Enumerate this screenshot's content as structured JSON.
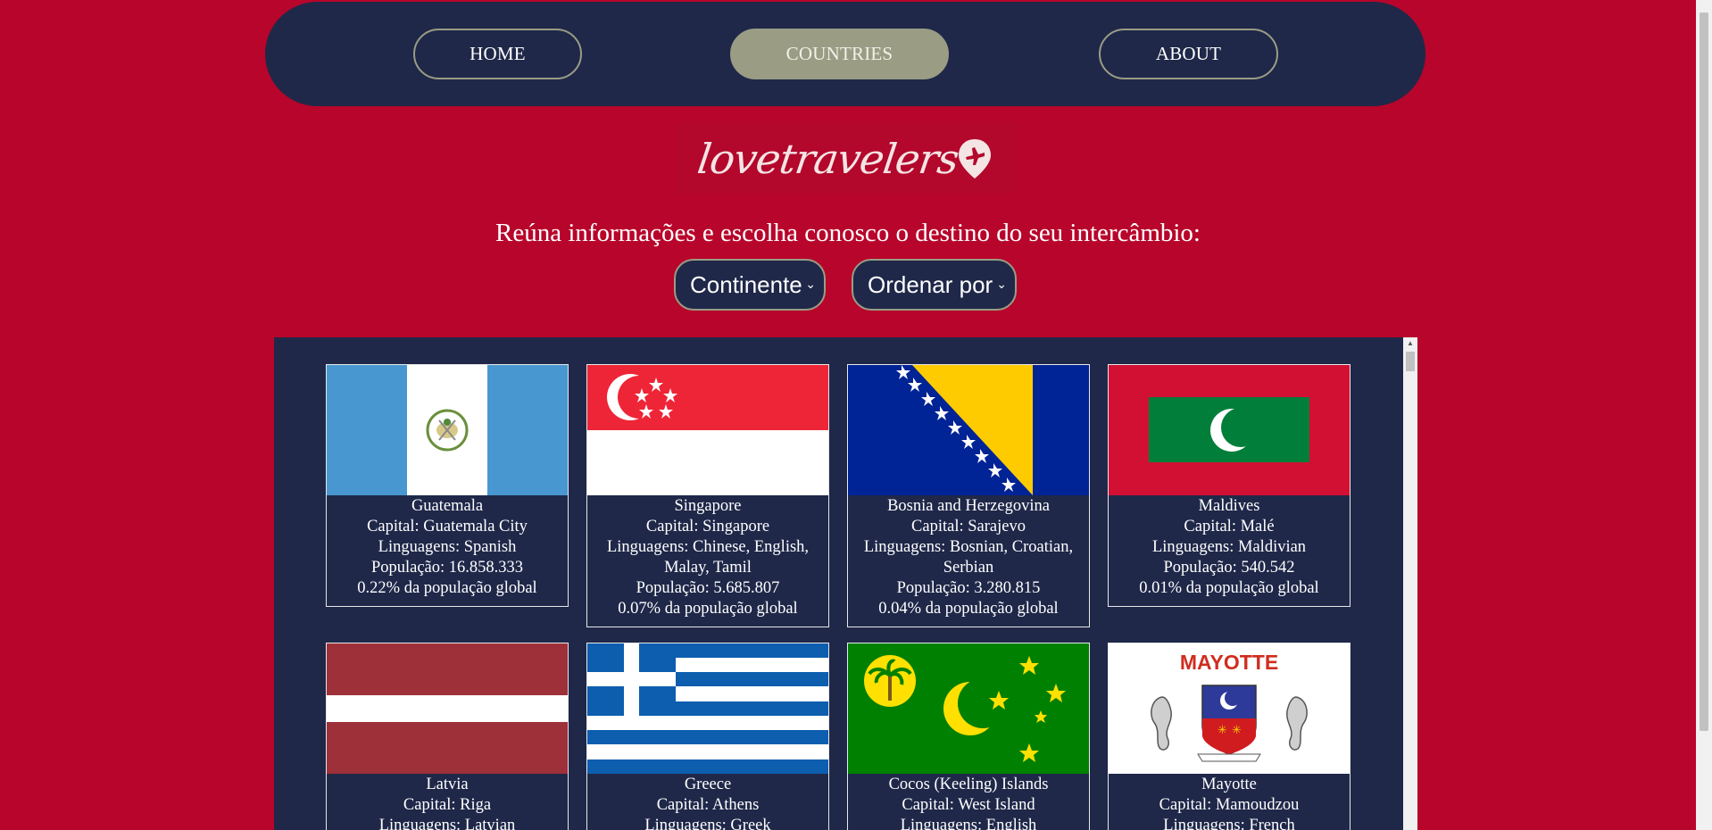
{
  "nav": {
    "home": "HOME",
    "countries": "COUNTRIES",
    "about": "ABOUT",
    "active": "COUNTRIES"
  },
  "logo": {
    "text": "lovetravelers"
  },
  "tagline": "Reúna informações e escolha conosco o destino do seu intercâmbio:",
  "filters": {
    "continent": {
      "selected": "Continente"
    },
    "sort": {
      "selected": "Ordenar por"
    }
  },
  "countries": [
    {
      "name": "Guatemala",
      "capital": "Capital: Guatemala City",
      "languages": "Linguagens: Spanish",
      "population": "População: 16.858.333",
      "share": "0.22% da população global",
      "flag": "guatemala-flag"
    },
    {
      "name": "Singapore",
      "capital": "Capital: Singapore",
      "languages": "Linguagens: Chinese, English, Malay, Tamil",
      "population": "População: 5.685.807",
      "share": "0.07% da população global",
      "flag": "singapore-flag"
    },
    {
      "name": "Bosnia and Herzegovina",
      "capital": "Capital: Sarajevo",
      "languages": "Linguagens: Bosnian, Croatian, Serbian",
      "population": "População: 3.280.815",
      "share": "0.04% da população global",
      "flag": "bosnia-flag"
    },
    {
      "name": "Maldives",
      "capital": "Capital: Malé",
      "languages": "Linguagens: Maldivian",
      "population": "População: 540.542",
      "share": "0.01% da população global",
      "flag": "maldives-flag"
    },
    {
      "name": "Latvia",
      "capital": "Capital: Riga",
      "languages": "Linguagens: Latvian",
      "flag": "latvia-flag"
    },
    {
      "name": "Greece",
      "capital": "Capital: Athens",
      "languages": "Linguagens: Greek",
      "flag": "greece-flag"
    },
    {
      "name": "Cocos (Keeling) Islands",
      "capital": "Capital: West Island",
      "languages": "Linguagens: English",
      "flag": "cocos-islands-flag"
    },
    {
      "name": "Mayotte",
      "capital": "Capital: Mamoudzou",
      "languages": "Linguagens: French",
      "flag": "mayotte-flag",
      "flag_text": "MAYOTTE"
    }
  ],
  "colors": {
    "background": "#b8052b",
    "navy": "#1f2849",
    "accent": "#9a9c84"
  }
}
